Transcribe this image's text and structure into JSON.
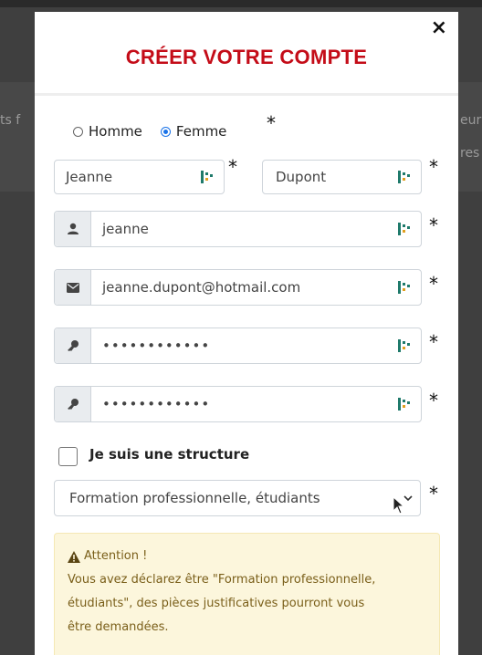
{
  "background": {
    "frag_left": "ts f",
    "frag_right_1": "eur",
    "frag_right_2": "res"
  },
  "modal": {
    "close_label": "×",
    "title": "CRÉER VOTRE COMPTE"
  },
  "gender": {
    "options": [
      {
        "label": "Homme",
        "checked": false
      },
      {
        "label": "Femme",
        "checked": true
      }
    ]
  },
  "required_mark": "*",
  "form": {
    "first_name": "Jeanne",
    "last_name": "Dupont",
    "username": "jeanne",
    "email": "jeanne.dupont@hotmail.com",
    "password": "••••••••••••",
    "password_confirm": "••••••••••••"
  },
  "structure_checkbox": {
    "label": "Je suis une structure",
    "checked": false
  },
  "category_select": {
    "selected": "Formation professionnelle, étudiants"
  },
  "alert": {
    "heading": "Attention !",
    "line1": "Vous avez déclarez être \"Formation professionnelle,",
    "line2": "étudiants\", des pièces justificatives pourront vous",
    "line3": "être demandées."
  },
  "colors": {
    "title": "#c40c18",
    "radio_accent": "#1a73e8",
    "alert_bg": "#fcf6dc",
    "alert_text": "#7a5f1a",
    "field_icon": "#1f7a6b"
  },
  "icons": {
    "username_addon": "user-icon",
    "email_addon": "envelope-icon",
    "password_addon": "key-icon",
    "field_trailing": "password-manager-icon",
    "alert": "warning-icon",
    "select": "chevron-down-icon"
  }
}
